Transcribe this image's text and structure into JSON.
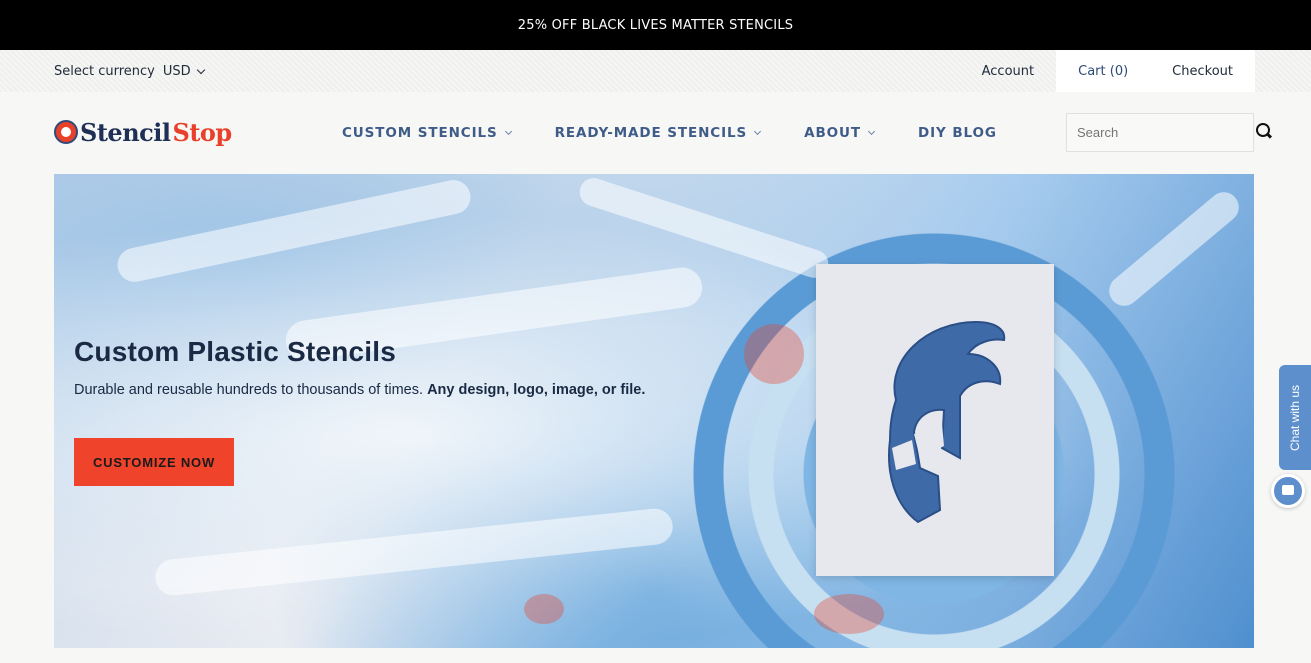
{
  "announcement": "25% OFF BLACK LIVES MATTER STENCILS",
  "topbar": {
    "currency_label": "Select currency",
    "currency_value": "USD",
    "links": {
      "account": "Account",
      "cart": "Cart (0)",
      "checkout": "Checkout"
    }
  },
  "header": {
    "logo": {
      "part1": "Stencil",
      "part2": "Stop"
    },
    "nav": [
      {
        "label": "CUSTOM STENCILS",
        "has_dropdown": true
      },
      {
        "label": "READY-MADE STENCILS",
        "has_dropdown": true
      },
      {
        "label": "ABOUT",
        "has_dropdown": true
      },
      {
        "label": "DIY BLOG",
        "has_dropdown": false
      }
    ],
    "search": {
      "placeholder": "Search",
      "icon": "search-icon"
    }
  },
  "hero": {
    "title": "Custom Plastic Stencils",
    "subtitle_plain": "Durable and reusable hundreds to thousands of times.",
    "subtitle_bold": "Any design, logo, image, or file.",
    "cta_label": "CUSTOMIZE NOW",
    "image_subject": "spartan-helmet-stencil"
  },
  "chat": {
    "label": "Chat with us",
    "icon": "chat-bubble-icon"
  },
  "colors": {
    "accent_red": "#f0432c",
    "nav_blue": "#3f5b88",
    "logo_navy": "#1f2f55",
    "chat_blue": "#5d8fcd",
    "announce_bg": "#000000"
  }
}
